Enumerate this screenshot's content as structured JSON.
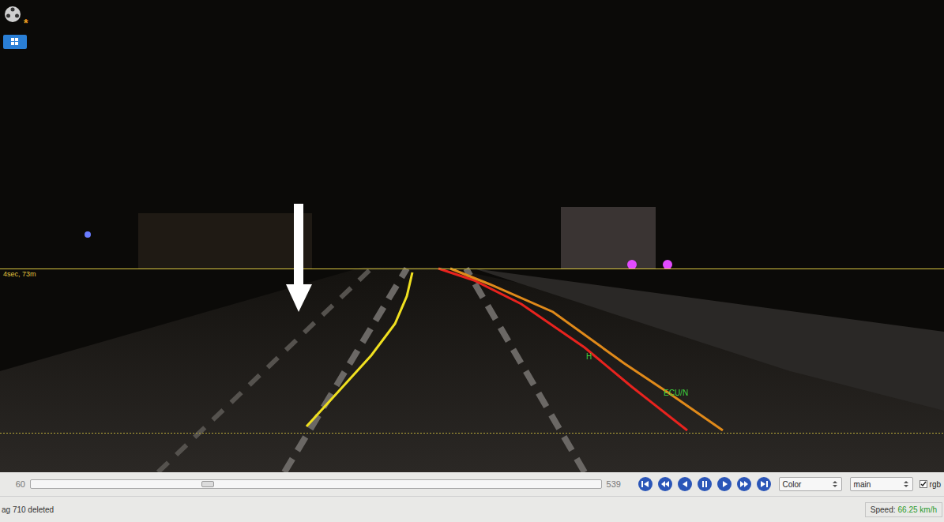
{
  "video": {
    "modified_marker": "*",
    "horizon_label": "4sec, 73m",
    "lane_labels": [
      {
        "text": "H",
        "color": "#3fd13f"
      },
      {
        "text": "ECU/N",
        "color": "#3fd13f"
      }
    ]
  },
  "controls": {
    "frame_start": "60",
    "frame_end": "539",
    "level": 0.31,
    "buttons": [
      {
        "kind": "first"
      },
      {
        "kind": "rewind"
      },
      {
        "kind": "prev"
      },
      {
        "kind": "pause"
      },
      {
        "kind": "play"
      },
      {
        "kind": "forward"
      },
      {
        "kind": "last"
      }
    ],
    "selects": [
      {
        "value": "Color"
      },
      {
        "value": "main"
      }
    ],
    "checkbox": {
      "label": "rgb",
      "checked": true
    }
  },
  "status_bar": {
    "message": "ag 710 deleted",
    "speed_label": "Speed:",
    "speed_value": "66.25 km/h"
  }
}
